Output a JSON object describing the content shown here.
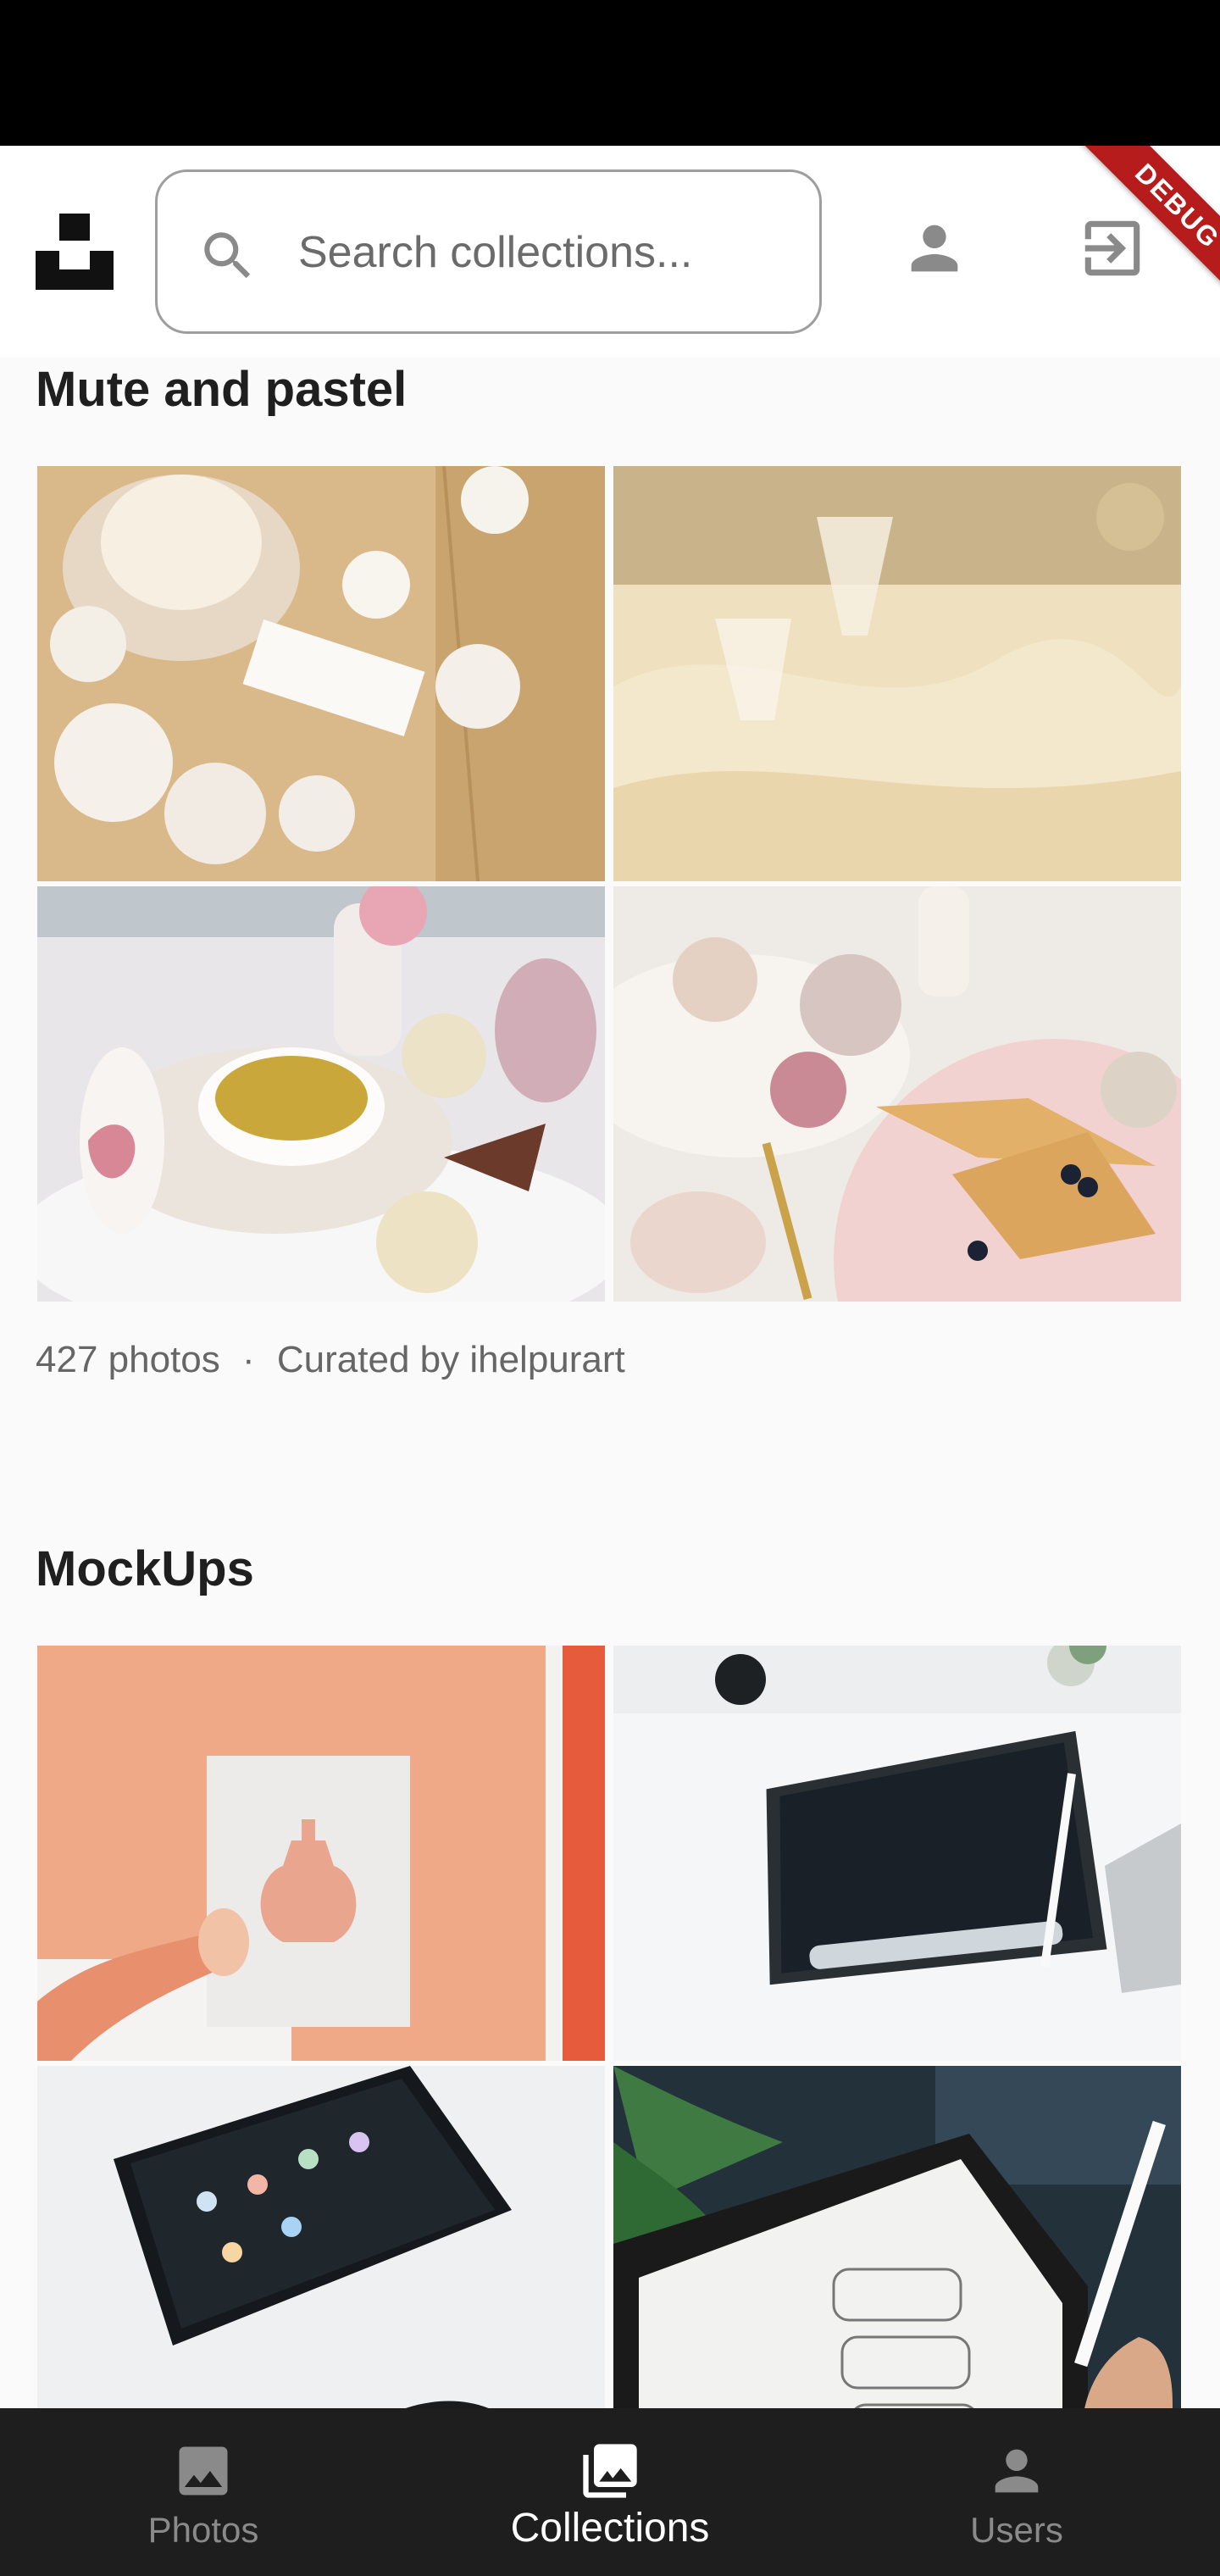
{
  "header": {
    "search_placeholder": "Search collections...",
    "debug_label": "DEBUG"
  },
  "collections": [
    {
      "title": "Mute and pastel",
      "photo_count": "427 photos",
      "separator": "·",
      "curator": "Curated by ihelpurart"
    },
    {
      "title": "MockUps"
    }
  ],
  "bottom_nav": {
    "items": [
      {
        "label": "Photos",
        "icon": "photo-icon",
        "active": false
      },
      {
        "label": "Collections",
        "icon": "collections-icon",
        "active": true
      },
      {
        "label": "Users",
        "icon": "user-icon",
        "active": false
      }
    ]
  },
  "colors": {
    "accent_active": "#ffffff",
    "nav_background": "#1e1e1e",
    "debug_banner": "#b71c1c"
  }
}
